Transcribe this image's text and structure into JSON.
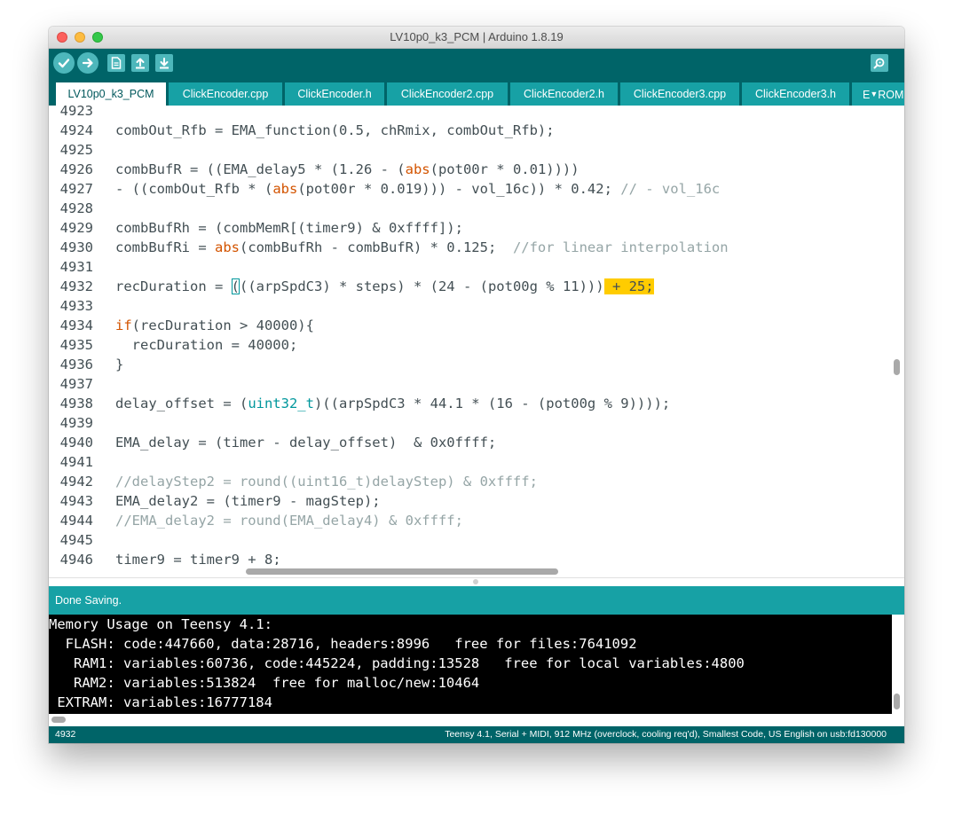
{
  "window": {
    "title": "LV10p0_k3_PCM | Arduino 1.8.19"
  },
  "toolbar": {
    "buttons": [
      {
        "name": "verify",
        "icon": "check-icon"
      },
      {
        "name": "upload",
        "icon": "arrow-right-icon"
      },
      {
        "name": "new",
        "icon": "new-file-icon"
      },
      {
        "name": "open",
        "icon": "arrow-up-icon"
      },
      {
        "name": "save",
        "icon": "arrow-down-icon"
      },
      {
        "name": "serial-monitor",
        "icon": "magnifier-icon"
      }
    ]
  },
  "tabs": [
    {
      "label": "LV10p0_k3_PCM",
      "active": true
    },
    {
      "label": "ClickEncoder.cpp",
      "active": false
    },
    {
      "label": "ClickEncoder.h",
      "active": false
    },
    {
      "label": "ClickEncoder2.cpp",
      "active": false
    },
    {
      "label": "ClickEncoder2.h",
      "active": false
    },
    {
      "label": "ClickEncoder3.cpp",
      "active": false
    },
    {
      "label": "ClickEncoder3.h",
      "active": false
    },
    {
      "label": "E",
      "active": false
    },
    {
      "label": "ROM",
      "active": false
    }
  ],
  "tab_menu_icon": "triangle-down-icon",
  "editor": {
    "lines": [
      {
        "n": "4923",
        "t": ""
      },
      {
        "n": "4924",
        "t": "combOut_Rfb = EMA_function(0.5, chRmix, combOut_Rfb);"
      },
      {
        "n": "4925",
        "t": ""
      },
      {
        "n": "4926",
        "t": "combBufR = ((EMA_delay5 * (1.26 - (abs(pot00r * 0.01))))"
      },
      {
        "n": "4927",
        "t": "- ((combOut_Rfb * (abs(pot00r * 0.019))) - vol_16c)) * 0.42; // - vol_16c"
      },
      {
        "n": "4928",
        "t": ""
      },
      {
        "n": "4929",
        "t": "combBufRh = (combMemR[(timer9) & 0xffff]);"
      },
      {
        "n": "4930",
        "t": "combBufRi = abs(combBufRh - combBufR) * 0.125;  //for linear interpolation"
      },
      {
        "n": "4931",
        "t": ""
      },
      {
        "n": "4932",
        "t": "recDuration = (((arpSpdC3) * steps) * (24 - (pot00g % 11))) + 25;"
      },
      {
        "n": "4933",
        "t": ""
      },
      {
        "n": "4934",
        "t": "if(recDuration > 40000){"
      },
      {
        "n": "4935",
        "t": "  recDuration = 40000;"
      },
      {
        "n": "4936",
        "t": "}"
      },
      {
        "n": "4937",
        "t": ""
      },
      {
        "n": "4938",
        "t": "delay_offset = (uint32_t)((arpSpdC3 * 44.1 * (16 - (pot00g % 9))));"
      },
      {
        "n": "4939",
        "t": ""
      },
      {
        "n": "4940",
        "t": "EMA_delay = (timer - delay_offset)  & 0x0ffff;"
      },
      {
        "n": "4941",
        "t": ""
      },
      {
        "n": "4942",
        "t": "//delayStep2 = round((uint16_t)delayStep) & 0xffff;"
      },
      {
        "n": "4943",
        "t": "EMA_delay2 = (timer9 - magStep);"
      },
      {
        "n": "4944",
        "t": "//EMA_delay2 = round(EMA_delay4) & 0xffff;"
      },
      {
        "n": "4945",
        "t": ""
      },
      {
        "n": "4946",
        "t": "timer9 = timer9 + 8;"
      }
    ]
  },
  "status": {
    "message": "Done Saving."
  },
  "console": {
    "lines": [
      "Memory Usage on Teensy 4.1:",
      "  FLASH: code:447660, data:28716, headers:8996   free for files:7641092",
      "   RAM1: variables:60736, code:445224, padding:13528   free for local variables:4800",
      "   RAM2: variables:513824  free for malloc/new:10464",
      " EXTRAM: variables:16777184"
    ]
  },
  "footer": {
    "line_number": "4932",
    "board_info": "Teensy 4.1, Serial + MIDI, 912 MHz (overclock, cooling req'd), Smallest Code, US English on usb:fd130000"
  },
  "colors": {
    "toolbar_bg": "#006468",
    "tab_bg": "#17a1a5",
    "keyword": "#d35400",
    "type": "#00979c",
    "comment": "#95a5a6",
    "highlight": "#ffcc00"
  }
}
